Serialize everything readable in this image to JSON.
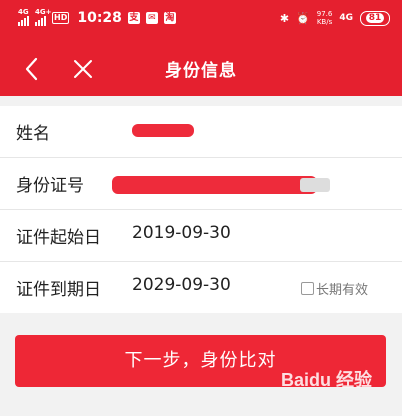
{
  "status_bar": {
    "signal_1": "4G",
    "signal_2": "4G+",
    "hd": "HD",
    "time": "10:28",
    "app_icon_1": "支",
    "app_icon_3": "淘",
    "net_speed_value": "97.6",
    "net_speed_unit": "KB/s",
    "net_type": "4G",
    "battery": "81"
  },
  "nav": {
    "title": "身份信息",
    "back_icon": "chevron-left",
    "close_icon": "x"
  },
  "form": {
    "name_label": "姓名",
    "id_label": "身份证号",
    "start_label": "证件起始日",
    "start_value": "2019-09-30",
    "end_label": "证件到期日",
    "end_value": "2029-09-30",
    "long_term_label": "长期有效",
    "long_term_checked": false
  },
  "next_button": "下一步，身份比对",
  "watermark": "Baidu 经验",
  "colors": {
    "brand": "#e5202f",
    "button": "#ee2736"
  }
}
